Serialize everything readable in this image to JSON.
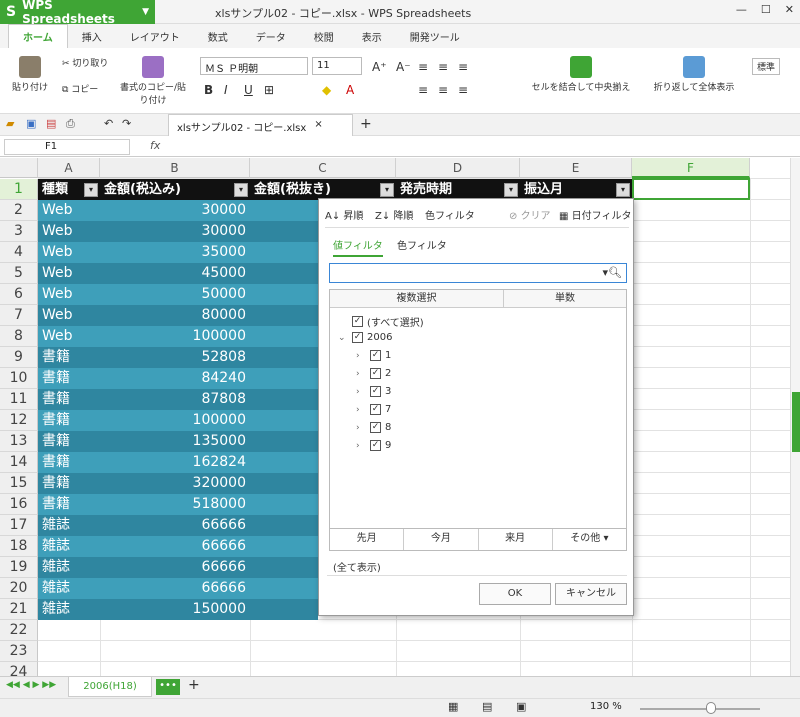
{
  "app": {
    "name": "WPS Spreadsheets",
    "title": "xlsサンプル02 - コピー.xlsx - WPS Spreadsheets",
    "accent": "#3fa535"
  },
  "ribbon_tabs": [
    "ホーム",
    "挿入",
    "レイアウト",
    "数式",
    "データ",
    "校閲",
    "表示",
    "開発ツール"
  ],
  "ribbon": {
    "paste": "貼り付け",
    "cut": "切り取り",
    "copy": "コピー",
    "format_copy": "書式のコピー/貼り付け",
    "font": "ＭＳ Ｐ明朝",
    "size": "11",
    "merge": "セルを結合して中央揃え",
    "wrap": "折り返して全体表示",
    "style": "標準"
  },
  "doc_tab": "xlsサンプル02 - コピー.xlsx",
  "namebox": "F1",
  "fx": "fx",
  "columns": [
    "A",
    "B",
    "C",
    "D",
    "E",
    "F"
  ],
  "header_row": [
    "種類",
    "金額(税込み)",
    "金額(税抜き)",
    "発売時期",
    "振込月"
  ],
  "rows": [
    [
      "Web",
      "30000"
    ],
    [
      "Web",
      "30000"
    ],
    [
      "Web",
      "35000"
    ],
    [
      "Web",
      "45000"
    ],
    [
      "Web",
      "50000"
    ],
    [
      "Web",
      "80000"
    ],
    [
      "Web",
      "100000"
    ],
    [
      "書籍",
      "52808"
    ],
    [
      "書籍",
      "84240"
    ],
    [
      "書籍",
      "87808"
    ],
    [
      "書籍",
      "100000"
    ],
    [
      "書籍",
      "135000"
    ],
    [
      "書籍",
      "162824"
    ],
    [
      "書籍",
      "320000"
    ],
    [
      "書籍",
      "518000"
    ],
    [
      "雑誌",
      "66666"
    ],
    [
      "雑誌",
      "66666"
    ],
    [
      "雑誌",
      "66666"
    ],
    [
      "雑誌",
      "66666"
    ],
    [
      "雑誌",
      "150000"
    ]
  ],
  "row_numbers": [
    "1",
    "2",
    "3",
    "4",
    "5",
    "6",
    "7",
    "8",
    "9",
    "10",
    "11",
    "12",
    "13",
    "14",
    "15",
    "16",
    "17",
    "18",
    "19",
    "20",
    "21",
    "22",
    "23",
    "24"
  ],
  "filter": {
    "sort_asc": "昇順",
    "sort_desc": "降順",
    "color_filter_top": "色フィルタ",
    "clear": "クリア",
    "date_filter": "日付フィルタ",
    "tab_value": "値フィルタ",
    "tab_color": "色フィルタ",
    "col_select": "複数選択",
    "col_count": "単数",
    "items": [
      {
        "label": "(すべて選択)",
        "level": 0
      },
      {
        "label": "2006",
        "level": 0
      },
      {
        "label": "1",
        "level": 1
      },
      {
        "label": "2",
        "level": 1
      },
      {
        "label": "3",
        "level": 1
      },
      {
        "label": "7",
        "level": 1
      },
      {
        "label": "8",
        "level": 1
      },
      {
        "label": "9",
        "level": 1
      }
    ],
    "quick": [
      "先月",
      "今月",
      "来月",
      "その他 ▾"
    ],
    "show_all": "(全て表示)",
    "ok": "OK",
    "cancel": "キャンセル"
  },
  "sheet_tab": "2006(H18)",
  "zoom": "130 %"
}
